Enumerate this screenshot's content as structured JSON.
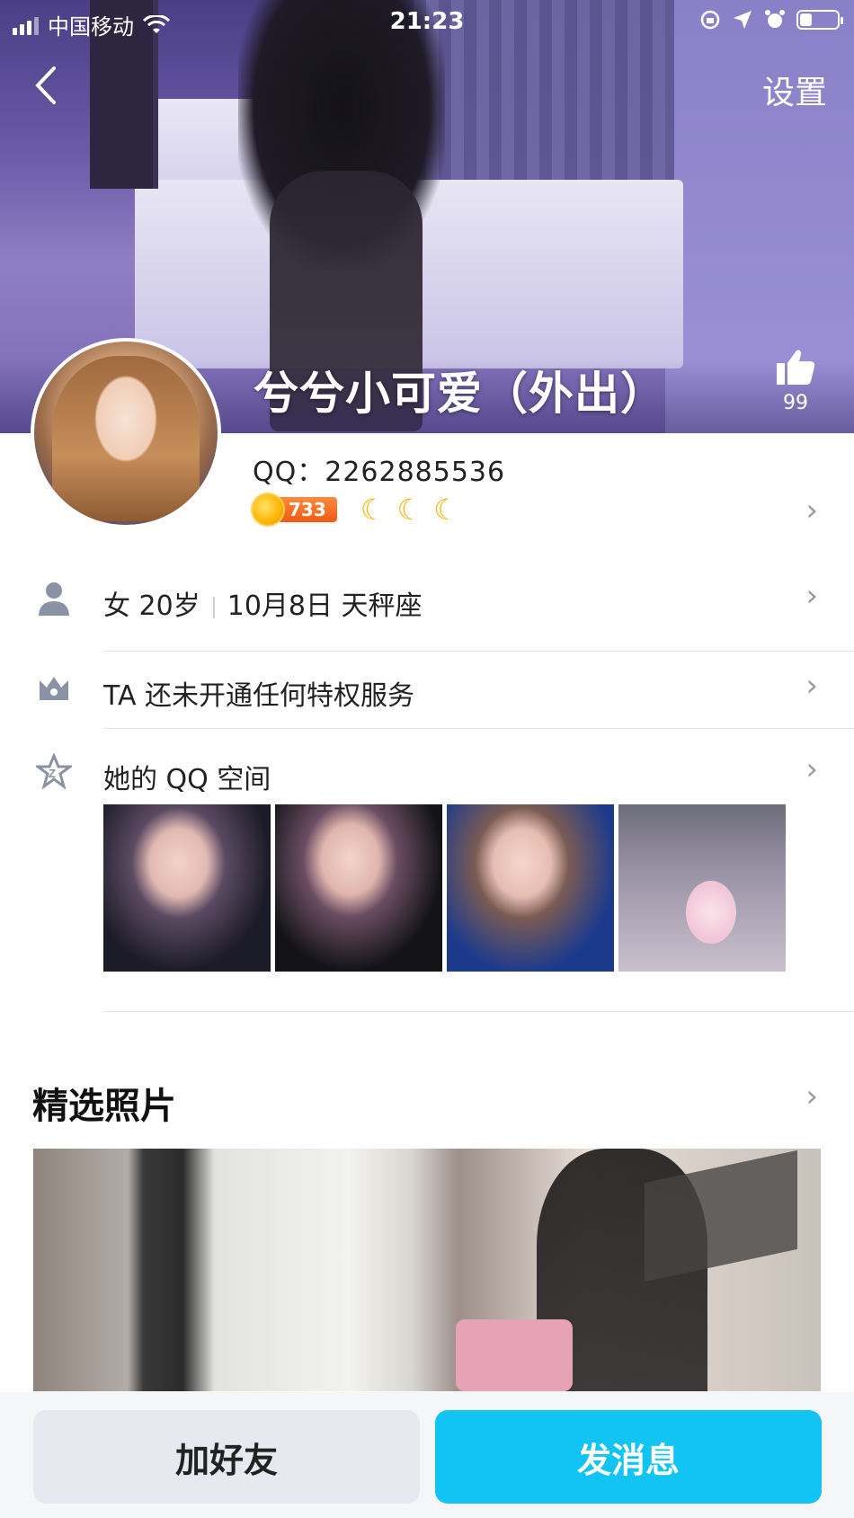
{
  "status_bar": {
    "carrier": "中国移动",
    "time": "21:23",
    "battery_level": 0.3
  },
  "header": {
    "settings_label": "设置",
    "nickname": "兮兮小可爱（外出）",
    "likes_count": "99"
  },
  "profile": {
    "qq_label": "QQ：2262885536",
    "level_value": "733",
    "gender": "女",
    "age": "20岁",
    "birthday": "10月8日",
    "constellation": "天秤座",
    "privilege_text": "TA 还未开通任何特权服务",
    "qzone_text": "她的 QQ 空间"
  },
  "featured": {
    "title": "精选照片"
  },
  "actions": {
    "add_friend": "加好友",
    "send_message": "发消息"
  },
  "colors": {
    "accent": "#12c4f4",
    "level_badge": "#f05a14",
    "moon": "#f5b70b"
  }
}
